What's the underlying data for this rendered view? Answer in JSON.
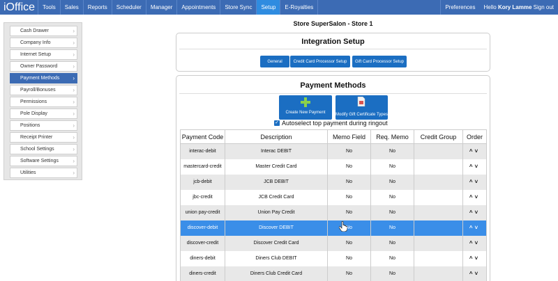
{
  "topnav": {
    "logo": "iOffice",
    "items": [
      {
        "label": "Tools"
      },
      {
        "label": "Sales"
      },
      {
        "label": "Reports"
      },
      {
        "label": "Scheduler"
      },
      {
        "label": "Manager"
      },
      {
        "label": "Appointments"
      },
      {
        "label": "Store Sync"
      },
      {
        "label": "Setup",
        "active": true
      },
      {
        "label": "E-Royalties"
      }
    ],
    "preferences": "Preferences",
    "hello_prefix": "Hello",
    "user_name": "Kory Lamme",
    "sign_out": "Sign out"
  },
  "sidebar": {
    "items": [
      {
        "label": "Cash Drawer"
      },
      {
        "label": "Company Info"
      },
      {
        "label": "Internet Setup"
      },
      {
        "label": "Owner Password"
      },
      {
        "label": "Payment Methods",
        "active": true
      },
      {
        "label": "Payroll/Bonuses"
      },
      {
        "label": "Permissions"
      },
      {
        "label": "Pole Display"
      },
      {
        "label": "Positions"
      },
      {
        "label": "Receipt Printer"
      },
      {
        "label": "School Settings"
      },
      {
        "label": "Software Settings"
      },
      {
        "label": "Utilities"
      }
    ]
  },
  "store_title": "Store SuperSalon - Store 1",
  "integration": {
    "title": "Integration Setup",
    "buttons": [
      "General",
      "Credit Card Processor Setup",
      "Gift Card Processor Setup"
    ]
  },
  "payment_methods": {
    "title": "Payment Methods",
    "create_button": "Create New Payment",
    "modify_button": "Modify Gift Certificate Types",
    "autoselect_label": "Autoselect top payment during ringout",
    "autoselect_checked": true,
    "columns": [
      "Payment Code",
      "Description",
      "Memo Field",
      "Req. Memo",
      "Credit Group",
      "Order"
    ],
    "rows": [
      {
        "code": "interac-debit",
        "description": "Interac DEBIT",
        "memo": "No",
        "req_memo": "No",
        "credit_group": ""
      },
      {
        "code": "mastercard-credit",
        "description": "Master Credit Card",
        "memo": "No",
        "req_memo": "No",
        "credit_group": ""
      },
      {
        "code": "jcb-debit",
        "description": "JCB DEBIT",
        "memo": "No",
        "req_memo": "No",
        "credit_group": ""
      },
      {
        "code": "jbc-credit",
        "description": "JCB Credit Card",
        "memo": "No",
        "req_memo": "No",
        "credit_group": ""
      },
      {
        "code": "union pay-credit",
        "description": "Union Pay Credit",
        "memo": "No",
        "req_memo": "No",
        "credit_group": ""
      },
      {
        "code": "discover-debit",
        "description": "Discover DEBIT",
        "memo": "No",
        "req_memo": "No",
        "credit_group": "",
        "selected": true
      },
      {
        "code": "discover-credit",
        "description": "Discover Credit Card",
        "memo": "No",
        "req_memo": "No",
        "credit_group": ""
      },
      {
        "code": "diners-debit",
        "description": "Diners Club DEBIT",
        "memo": "No",
        "req_memo": "No",
        "credit_group": ""
      },
      {
        "code": "diners-credit",
        "description": "Diners Club Credit Card",
        "memo": "No",
        "req_memo": "No",
        "credit_group": ""
      }
    ],
    "order_up_icon": "chevron-up-icon",
    "order_down_icon": "chevron-down-icon"
  },
  "colors": {
    "nav_bg": "#3c6bb4",
    "nav_active": "#2f8ce0",
    "button_blue": "#1b6ec2",
    "selected_row": "#3a8ee8"
  }
}
